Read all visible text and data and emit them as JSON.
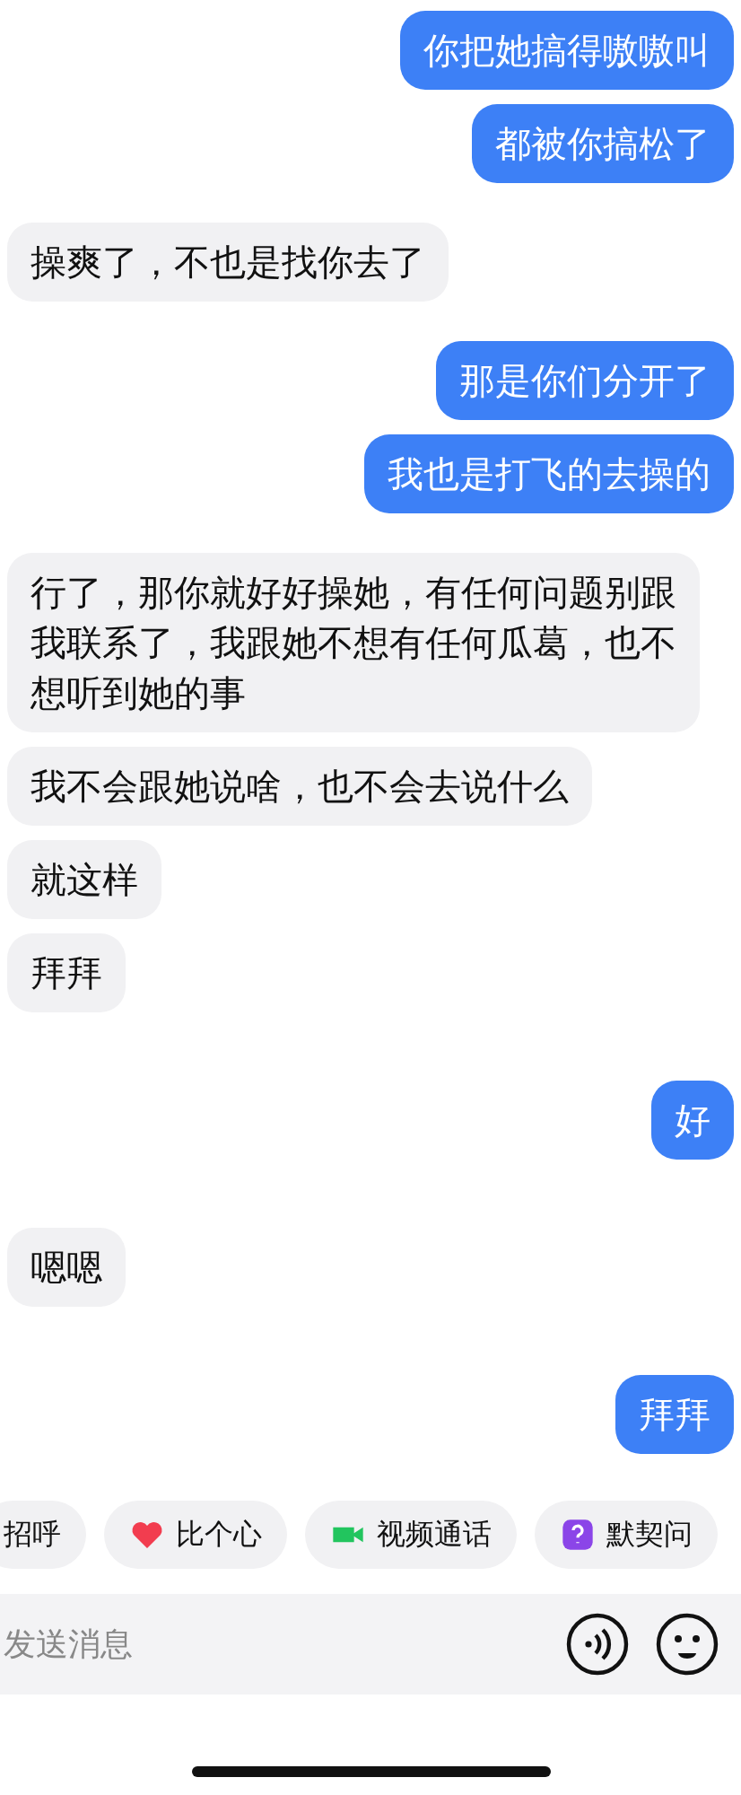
{
  "messages": [
    {
      "kind": "outgoing",
      "text": "你把她搞得嗷嗷叫"
    },
    {
      "kind": "outgoing",
      "text": "都被你搞松了"
    },
    {
      "kind": "incoming",
      "text": "操爽了，不也是找你去了"
    },
    {
      "kind": "outgoing",
      "text": "那是你们分开了"
    },
    {
      "kind": "outgoing",
      "text": "我也是打飞的去操的"
    },
    {
      "kind": "incoming",
      "text": "行了，那你就好好操她，有任何问题别跟我联系了，我跟她不想有任何瓜葛，也不想听到她的事"
    },
    {
      "kind": "incoming",
      "text": "我不会跟她说啥，也不会去说什么"
    },
    {
      "kind": "incoming",
      "text": "就这样"
    },
    {
      "kind": "incoming",
      "text": "拜拜"
    },
    {
      "kind": "outgoing",
      "text": "好"
    },
    {
      "kind": "incoming",
      "text": "嗯嗯"
    },
    {
      "kind": "outgoing",
      "text": "拜拜"
    }
  ],
  "quick_replies": [
    {
      "kind": "text",
      "label": "招呼"
    },
    {
      "kind": "heart",
      "label": "比个心"
    },
    {
      "kind": "video",
      "label": "视频通话"
    },
    {
      "kind": "question",
      "label": "默契问"
    }
  ],
  "input": {
    "placeholder": "发送消息"
  }
}
